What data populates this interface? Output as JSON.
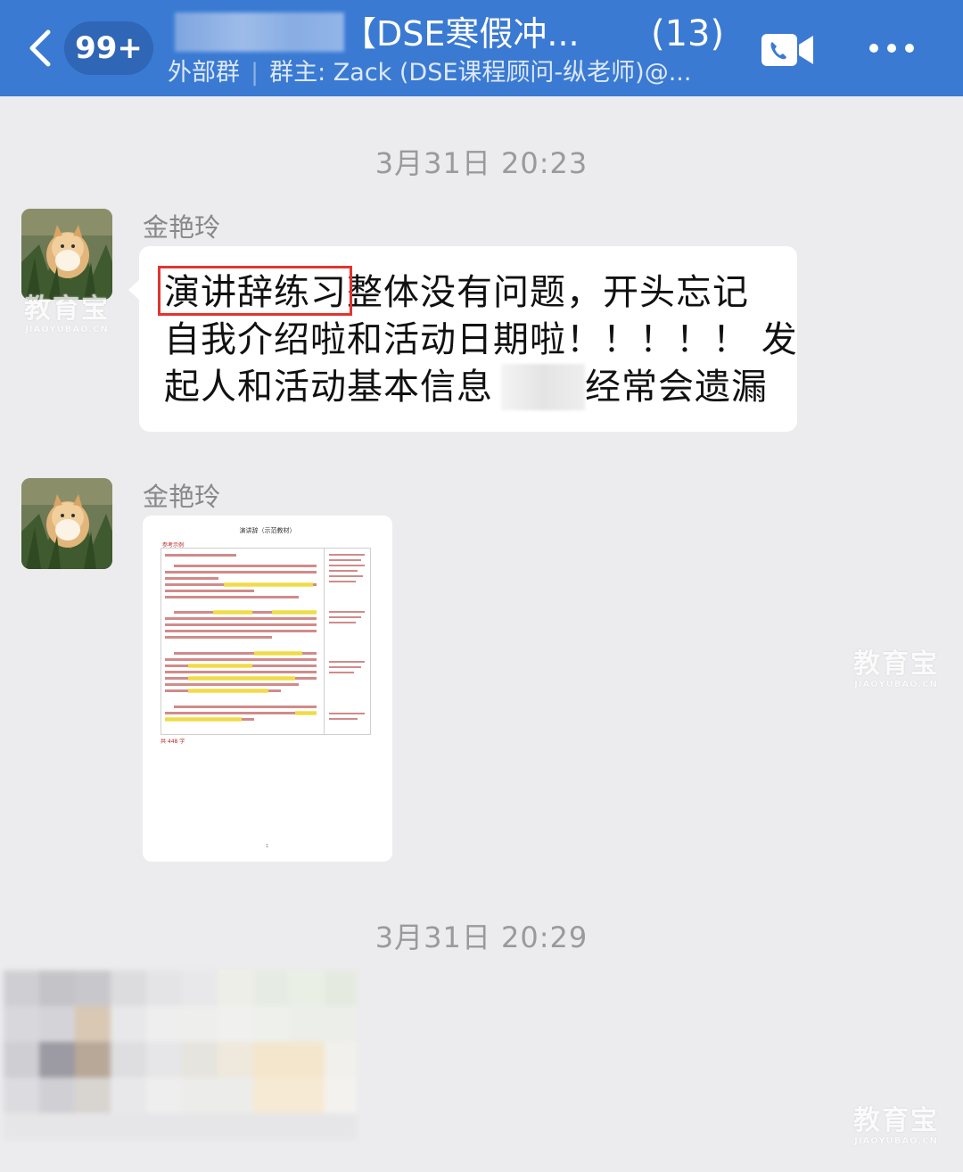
{
  "header": {
    "unread_badge": "99+",
    "title": "【DSE寒假冲...",
    "member_count": "(13)",
    "subtitle_tag": "外部群",
    "subtitle_owner": "群主: Zack (DSE课程顾问-纵老师)@...",
    "accent": "#3a7ad3"
  },
  "icons": {
    "back": "chevron-left-icon",
    "video_call": "video-call-icon",
    "more": "more-icon"
  },
  "timestamps": [
    "3月31日 20:23",
    "3月31日 20:29"
  ],
  "messages": [
    {
      "sender": "金艳玲",
      "type": "text",
      "lines": [
        "演讲辞练习整体没有问题，开头忘记",
        "自我介绍啦和活动日期啦！！！！！ 发",
        "起人和活动基本信息",
        "经常会遗漏"
      ],
      "highlighted_phrase": "演讲辞练习"
    },
    {
      "sender": "金艳玲",
      "type": "document",
      "doc_title": "演讲辞（示范教材）",
      "doc_label": "参考示例",
      "doc_footer": "共 448 字",
      "doc_page": "1"
    }
  ],
  "watermark": {
    "main": "教育宝",
    "sub": "JIAOYUBAO.CN"
  }
}
